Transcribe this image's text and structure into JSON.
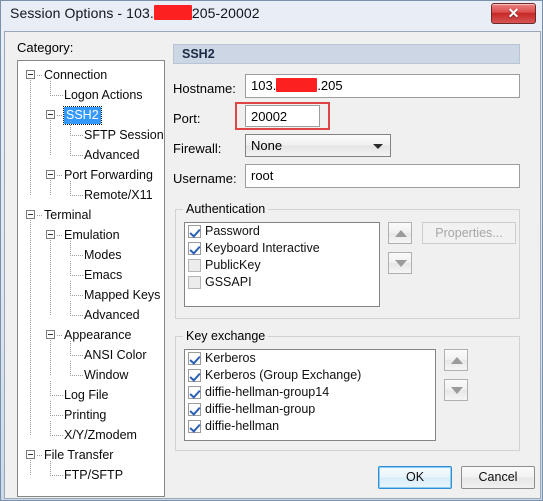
{
  "window": {
    "title_prefix": "Session Options - 103.",
    "title_suffix": "205-20002",
    "close_label": "✕"
  },
  "sidebar": {
    "label": "Category:",
    "items": [
      {
        "label": "Connection",
        "depth": 0,
        "expandable": true,
        "selected": false
      },
      {
        "label": "Logon Actions",
        "depth": 1,
        "expandable": false,
        "selected": false
      },
      {
        "label": "SSH2",
        "depth": 1,
        "expandable": true,
        "selected": true
      },
      {
        "label": "SFTP Session",
        "depth": 2,
        "expandable": false,
        "selected": false
      },
      {
        "label": "Advanced",
        "depth": 2,
        "expandable": false,
        "selected": false
      },
      {
        "label": "Port Forwarding",
        "depth": 1,
        "expandable": true,
        "selected": false
      },
      {
        "label": "Remote/X11",
        "depth": 2,
        "expandable": false,
        "selected": false
      },
      {
        "label": "Terminal",
        "depth": 0,
        "expandable": true,
        "selected": false
      },
      {
        "label": "Emulation",
        "depth": 1,
        "expandable": true,
        "selected": false
      },
      {
        "label": "Modes",
        "depth": 2,
        "expandable": false,
        "selected": false
      },
      {
        "label": "Emacs",
        "depth": 2,
        "expandable": false,
        "selected": false
      },
      {
        "label": "Mapped Keys",
        "depth": 2,
        "expandable": false,
        "selected": false
      },
      {
        "label": "Advanced",
        "depth": 2,
        "expandable": false,
        "selected": false
      },
      {
        "label": "Appearance",
        "depth": 1,
        "expandable": true,
        "selected": false
      },
      {
        "label": "ANSI Color",
        "depth": 2,
        "expandable": false,
        "selected": false
      },
      {
        "label": "Window",
        "depth": 2,
        "expandable": false,
        "selected": false
      },
      {
        "label": "Log File",
        "depth": 1,
        "expandable": false,
        "selected": false
      },
      {
        "label": "Printing",
        "depth": 1,
        "expandable": false,
        "selected": false
      },
      {
        "label": "X/Y/Zmodem",
        "depth": 1,
        "expandable": false,
        "selected": false
      },
      {
        "label": "File Transfer",
        "depth": 0,
        "expandable": true,
        "selected": false
      },
      {
        "label": "FTP/SFTP",
        "depth": 1,
        "expandable": false,
        "selected": false
      }
    ]
  },
  "panel": {
    "header": "SSH2",
    "fields": {
      "hostname": {
        "label": "Hostname:",
        "value_prefix": "103.",
        "value_suffix": ".205"
      },
      "port": {
        "label": "Port:",
        "value": "20002",
        "highlight_color": "#e04545"
      },
      "firewall": {
        "label": "Firewall:",
        "value": "None"
      },
      "username": {
        "label": "Username:",
        "value": "root"
      }
    },
    "authentication": {
      "title": "Authentication",
      "items": [
        {
          "label": "Password",
          "checked": true
        },
        {
          "label": "Keyboard Interactive",
          "checked": true
        },
        {
          "label": "PublicKey",
          "checked": false
        },
        {
          "label": "GSSAPI",
          "checked": false
        }
      ],
      "move_up_icon": "triangle-up-icon",
      "move_down_icon": "triangle-down-icon",
      "properties_label": "Properties...",
      "properties_enabled": false
    },
    "key_exchange": {
      "title": "Key exchange",
      "items": [
        {
          "label": "Kerberos",
          "checked": true
        },
        {
          "label": "Kerberos (Group Exchange)",
          "checked": true
        },
        {
          "label": "diffie-hellman-group14",
          "checked": true
        },
        {
          "label": "diffie-hellman-group",
          "checked": true
        },
        {
          "label": "diffie-hellman",
          "checked": true
        }
      ],
      "move_up_icon": "triangle-up-icon",
      "move_down_icon": "triangle-down-icon"
    }
  },
  "footer": {
    "ok_label": "OK",
    "cancel_label": "Cancel"
  }
}
